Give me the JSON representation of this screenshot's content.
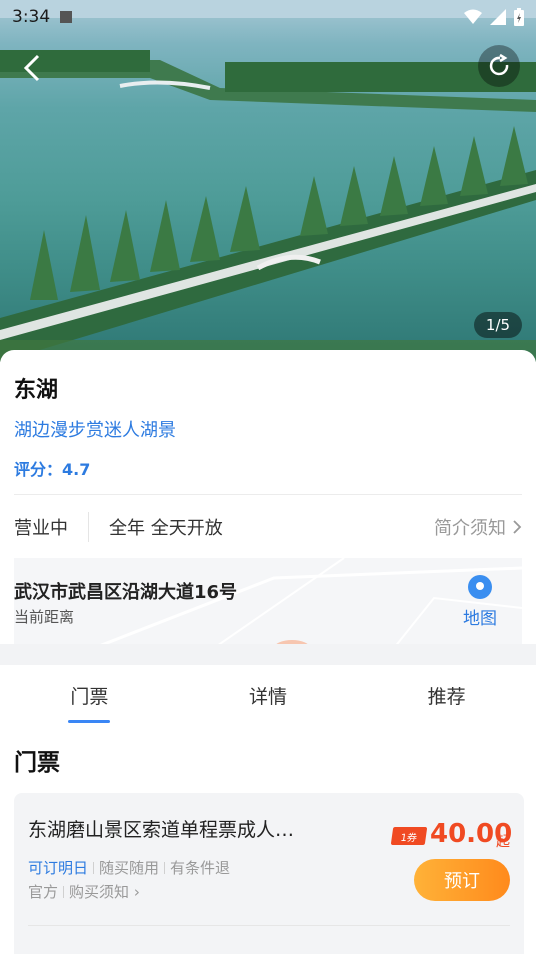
{
  "status_bar": {
    "time": "3:34"
  },
  "hero": {
    "counter": "1/5"
  },
  "info": {
    "title": "东湖",
    "subtitle": "湖边漫步赏迷人湖景",
    "rating": "评分：4.7",
    "open_status": "营业中",
    "open_hours": "全年 全天开放",
    "notice_link": "简介须知",
    "address": "武汉市武昌区沿湖大道16号",
    "distance_label": "当前距离",
    "map_label": "地图"
  },
  "tabs": [
    {
      "label": "门票"
    },
    {
      "label": "详情"
    },
    {
      "label": "推荐"
    }
  ],
  "section_title": "门票",
  "ticket": {
    "name": "东湖磨山景区索道单程票成人…",
    "tag_available": "可订明日",
    "tag_anytime": "随买随用",
    "tag_refund": "有条件退",
    "tag_official": "官方",
    "tag_notice": "购买须知",
    "coupon_label": "1券",
    "price": "40.00",
    "price_suffix": "起",
    "book_label": "预订"
  },
  "colors": {
    "accent_blue": "#2d7be0",
    "price_red": "#f04a22",
    "book_orange": "#ff8a1c"
  }
}
